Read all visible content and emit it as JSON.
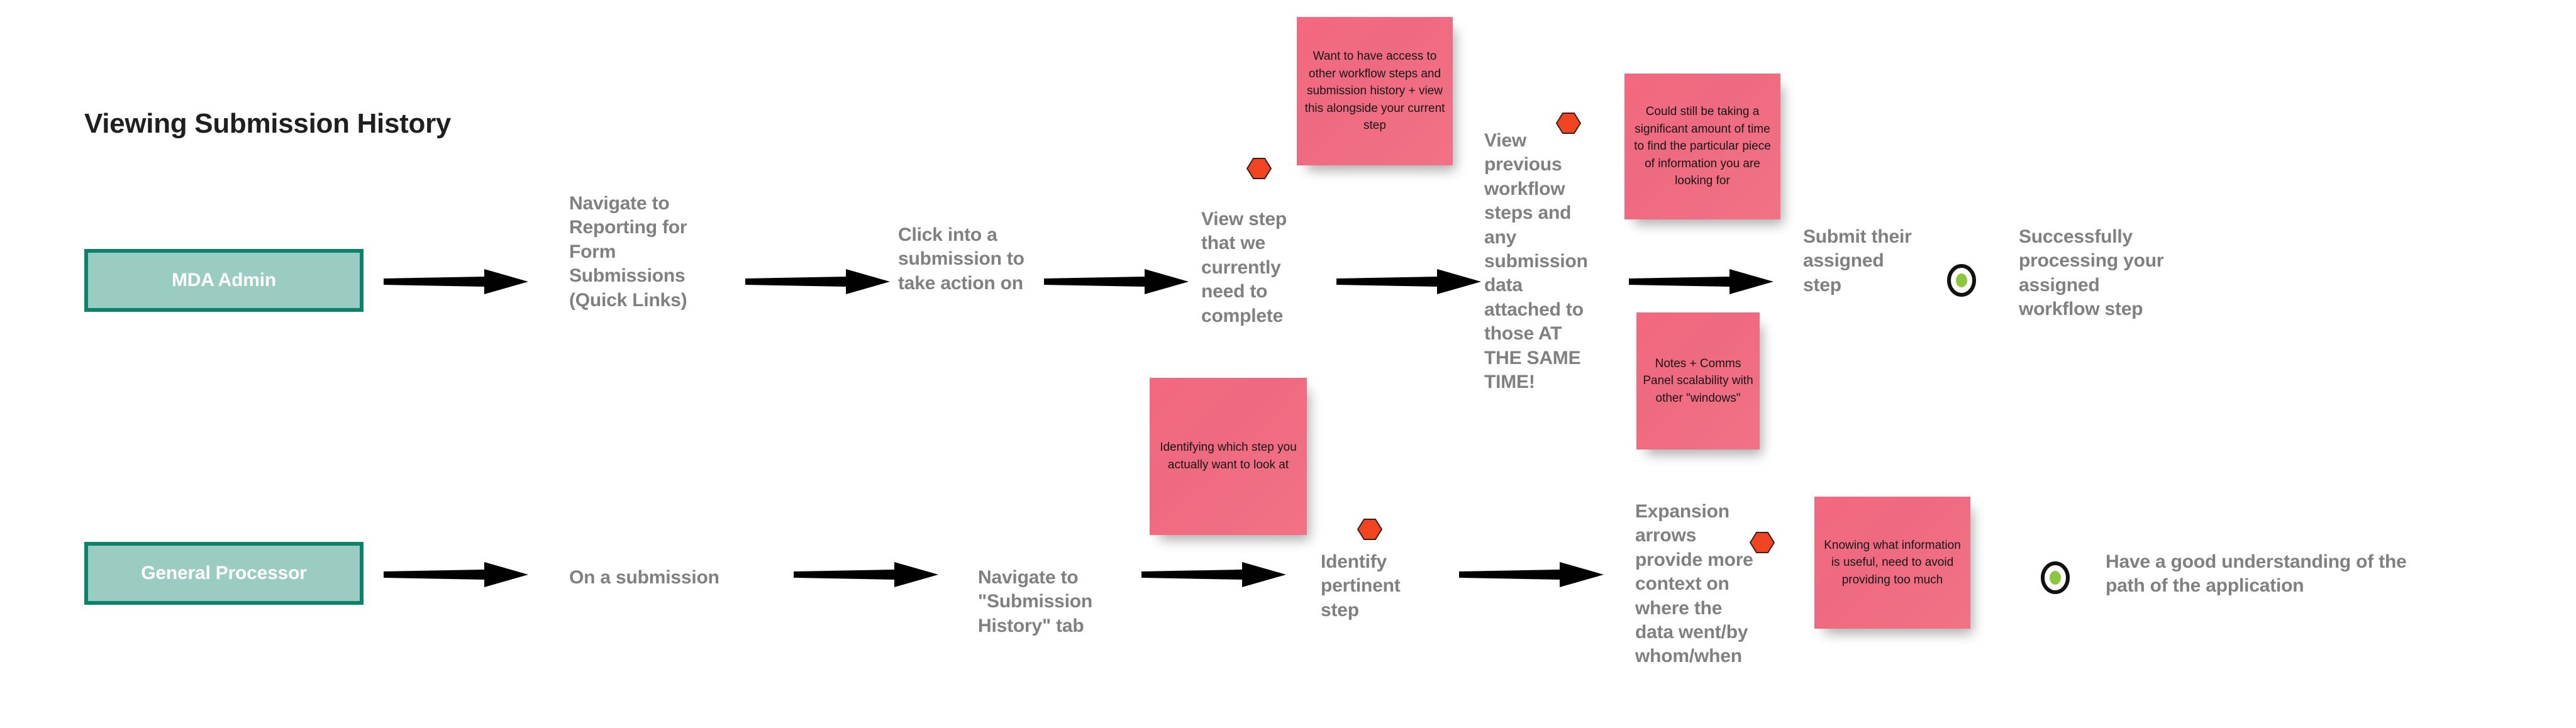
{
  "page": {
    "title": "Viewing Submission History",
    "colors": {
      "role_box_fill": "#9BCCC1",
      "role_box_border": "#0E8268",
      "step_text": "#808080",
      "sticky_note": "#F0697F",
      "hexagon": "#F04423",
      "target_center": "#8CC63E",
      "title_text": "#1F1F1F"
    }
  },
  "lanes": [
    {
      "role": "MDA Admin",
      "steps": [
        "Navigate to Reporting for Form Submissions (Quick Links)",
        "Click into a submission to take action on",
        "View step that we currently need to complete",
        "View previous workflow steps and any submission data attached to those AT THE SAME TIME!",
        "Submit their assigned step"
      ],
      "outcome": "Successfully processing your assigned workflow step"
    },
    {
      "role": "General Processor",
      "steps": [
        "On a submission",
        "Navigate to \"Submission History\" tab",
        "Identify pertinent step",
        "Expansion arrows provide more context on where the data went/by whom/when"
      ],
      "outcome": "Have a good understanding of the path of the application"
    }
  ],
  "sticky_notes": [
    {
      "id": "note-workflow-access",
      "text": "Want to have access to other workflow steps and submission history + view this alongside your current step"
    },
    {
      "id": "note-time-to-find",
      "text": "Could still be taking a significant amount of time to find the particular piece of information you are looking for"
    },
    {
      "id": "note-notes-comms-panel",
      "text": "Notes + Comms Panel scalability with other \"windows\""
    },
    {
      "id": "note-identifying-step",
      "text": "Identifying which step you actually want to look at"
    },
    {
      "id": "note-knowing-what-info",
      "text": "Knowing what information is useful, need to avoid providing too much"
    }
  ],
  "icons": {
    "hexagon": "hexagon-marker-icon",
    "target": "bullseye-target-icon",
    "arrow": "right-arrow-icon"
  }
}
